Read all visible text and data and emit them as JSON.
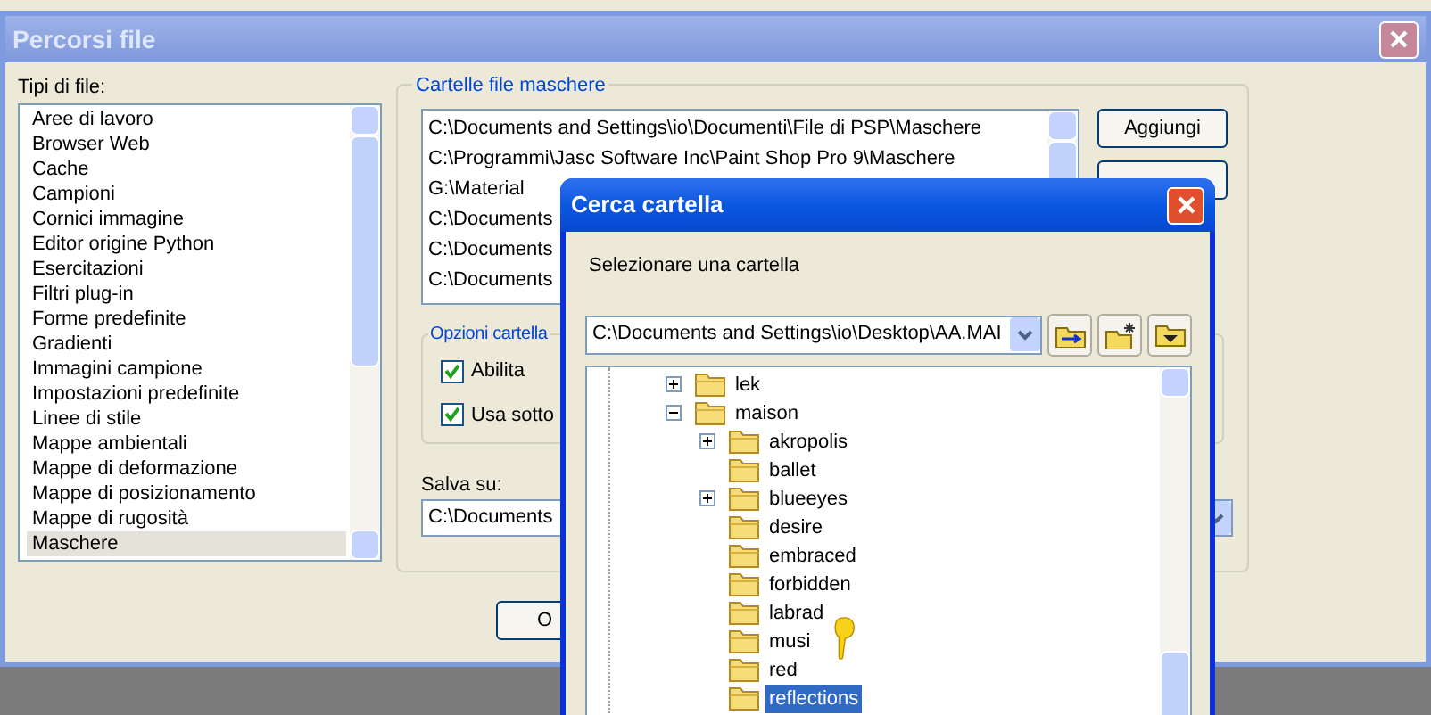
{
  "paths_dialog": {
    "title": "Percorsi file",
    "file_types_label": "Tipi di file:",
    "file_types": [
      {
        "label": "Aree di lavoro",
        "selected": false
      },
      {
        "label": "Browser Web",
        "selected": false
      },
      {
        "label": "Cache",
        "selected": false
      },
      {
        "label": "Campioni",
        "selected": false
      },
      {
        "label": "Cornici immagine",
        "selected": false
      },
      {
        "label": "Editor origine Python",
        "selected": false
      },
      {
        "label": "Esercitazioni",
        "selected": false
      },
      {
        "label": "Filtri plug-in",
        "selected": false
      },
      {
        "label": "Forme predefinite",
        "selected": false
      },
      {
        "label": "Gradienti",
        "selected": false
      },
      {
        "label": "Immagini campione",
        "selected": false
      },
      {
        "label": "Impostazioni predefinite",
        "selected": false
      },
      {
        "label": "Linee di stile",
        "selected": false
      },
      {
        "label": "Mappe ambientali",
        "selected": false
      },
      {
        "label": "Mappe di deformazione",
        "selected": false
      },
      {
        "label": "Mappe di posizionamento",
        "selected": false
      },
      {
        "label": "Mappe di rugosità",
        "selected": false
      },
      {
        "label": "Maschere",
        "selected": true
      }
    ],
    "mask_folders": {
      "legend": "Cartelle file maschere",
      "paths": [
        "C:\\Documents and Settings\\io\\Documenti\\File di PSP\\Maschere",
        "C:\\Programmi\\Jasc Software Inc\\Paint Shop Pro 9\\Maschere",
        "G:\\Material",
        "C:\\Documents",
        "C:\\Documents",
        "C:\\Documents"
      ],
      "buttons": [
        "Aggiungi"
      ]
    },
    "folder_options": {
      "legend": "Opzioni cartella",
      "checkboxes": [
        {
          "label": "Abilita",
          "checked": true
        },
        {
          "label": "Usa sotto",
          "checked": true
        }
      ]
    },
    "save_to": {
      "label": "Salva su:",
      "value": "C:\\Documents"
    },
    "ok_button": "O"
  },
  "browse_dialog": {
    "title": "Cerca cartella",
    "prompt": "Selezionare una cartella",
    "path": "C:\\Documents and Settings\\io\\Desktop\\AA.MAI",
    "tree": [
      {
        "label": "lek",
        "expanded": false,
        "selected": false
      },
      {
        "label": "maison",
        "expanded": true,
        "selected": false,
        "children": [
          {
            "label": "akropolis",
            "expanded": false,
            "selected": false
          },
          {
            "label": "ballet",
            "selected": false
          },
          {
            "label": "blueeyes",
            "expanded": false,
            "selected": false
          },
          {
            "label": "desire",
            "selected": false
          },
          {
            "label": "embraced",
            "selected": false
          },
          {
            "label": "forbidden",
            "selected": false
          },
          {
            "label": "labrad",
            "selected": false
          },
          {
            "label": "musi",
            "selected": false
          },
          {
            "label": "red",
            "selected": false
          },
          {
            "label": "reflections",
            "selected": true
          }
        ]
      }
    ]
  }
}
